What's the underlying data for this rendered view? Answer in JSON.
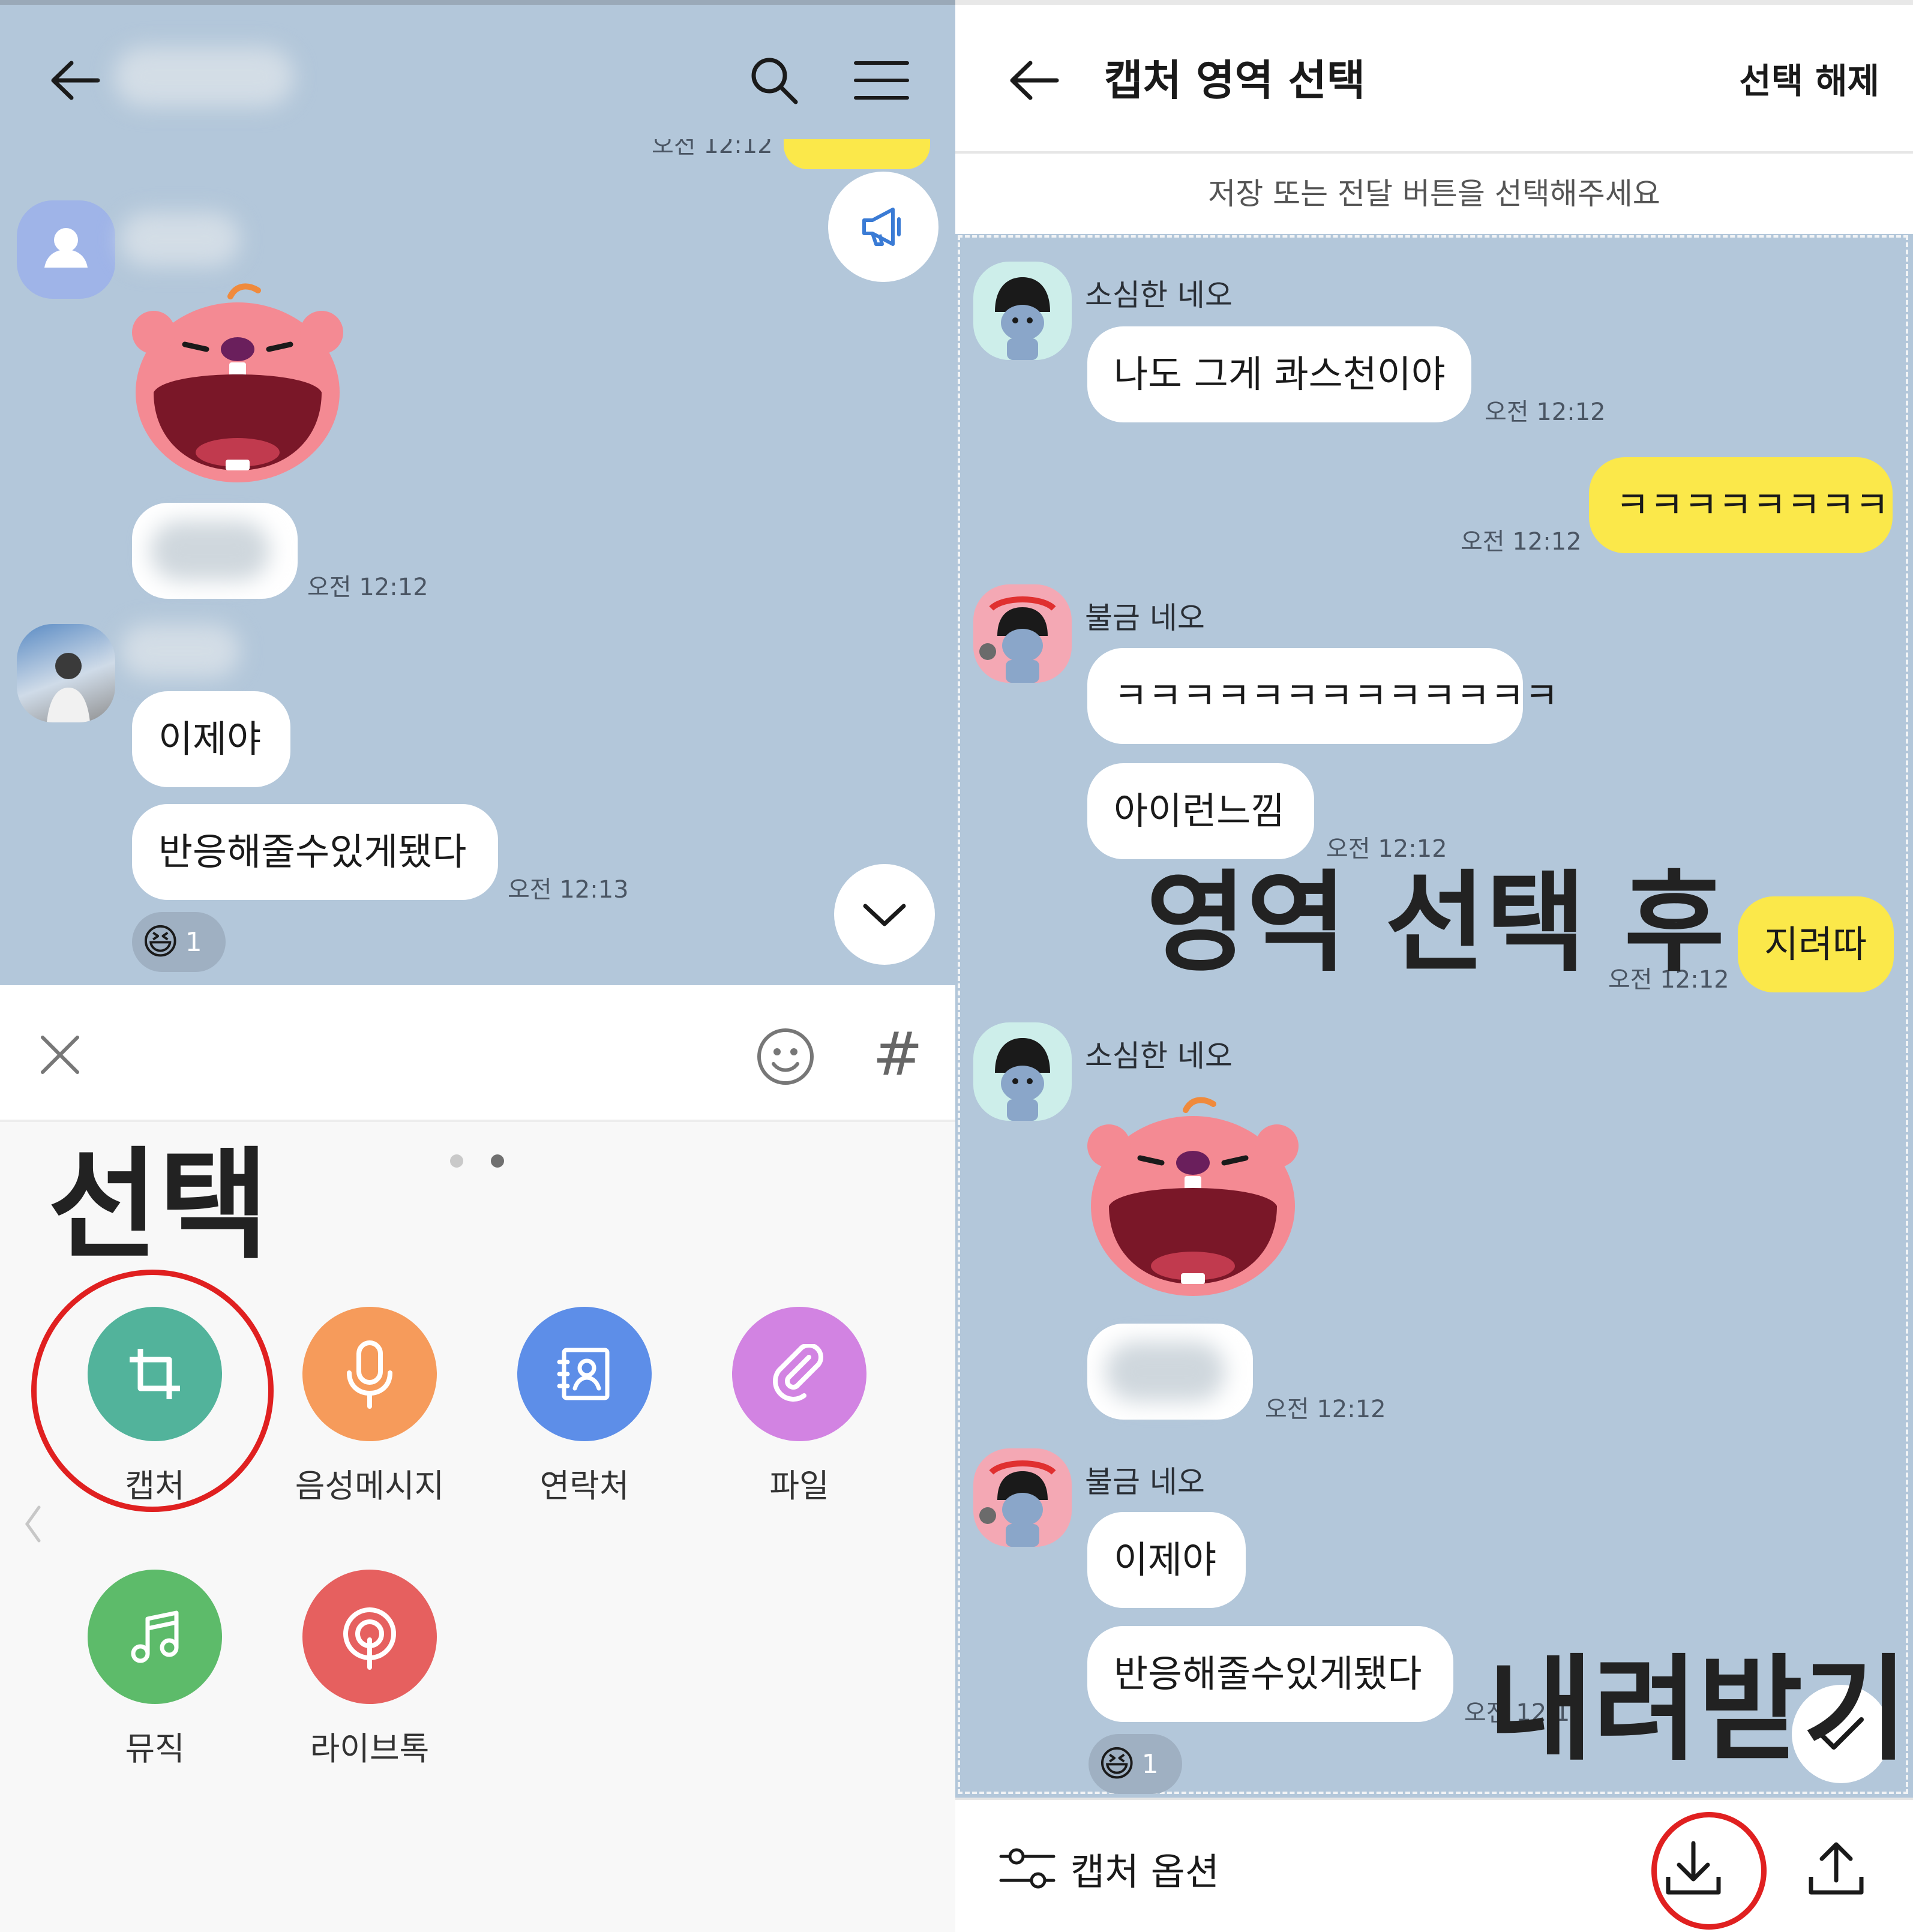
{
  "left": {
    "partial_top_time": "오전 12:12",
    "messages": [
      {
        "time": "오전 12:12"
      },
      {
        "text": "이제야"
      },
      {
        "text": "반응해줄수있게됐다",
        "time": "오전 12:13",
        "reaction_count": "1"
      }
    ],
    "overlay_label": "선택",
    "actions": [
      {
        "label": "캡처",
        "color": "#52b39b"
      },
      {
        "label": "음성메시지",
        "color": "#f69b5b"
      },
      {
        "label": "연락처",
        "color": "#5d8ee8"
      },
      {
        "label": "파일",
        "color": "#d283e2"
      },
      {
        "label": "뮤직",
        "color": "#5dbb6a"
      },
      {
        "label": "라이브톡",
        "color": "#e6605f"
      }
    ],
    "hash_symbol": "#"
  },
  "right": {
    "header_title": "캡처 영역 선택",
    "header_action": "선택 해제",
    "hint": "저장 또는 전달 버튼을 선택해주세요",
    "messages": [
      {
        "sender": "소심한 네오",
        "text": "나도 그게 콰스천이야",
        "time": "오전 12:12"
      },
      {
        "mine": true,
        "text": "ㅋㅋㅋㅋㅋㅋㅋㅋ",
        "time": "오전 12:12"
      },
      {
        "sender": "불금 네오",
        "text": "ㅋㅋㅋㅋㅋㅋㅋㅋㅋㅋㅋㅋㅋ"
      },
      {
        "text": "아이런느낌",
        "time": "오전 12:12"
      },
      {
        "mine": true,
        "text": "지려따",
        "time": "오전 12:12"
      },
      {
        "sender": "소심한 네오"
      },
      {
        "time": "오전 12:12"
      },
      {
        "sender": "불금 네오",
        "text": "이제야"
      },
      {
        "text": "반응해줄수있게됐다",
        "time": "오전 12:12",
        "reaction_count": "1"
      }
    ],
    "overlay_after": "영역 선택 후",
    "overlay_download": "내려받기",
    "capture_options": "캡처 옵션"
  },
  "colors": {
    "chat_bg": "#b3c7da",
    "my_bubble": "#fbe84a",
    "highlight_red": "#e02020"
  }
}
